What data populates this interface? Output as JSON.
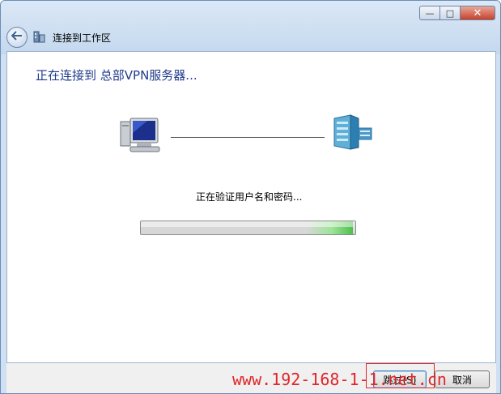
{
  "window": {
    "title": "连接到工作区",
    "caption_min": "—",
    "caption_max": "□",
    "caption_close": "✕"
  },
  "main": {
    "heading": "正在连接到 总部VPN服务器...",
    "status_text": "正在验证用户名和密码...",
    "progress_fraction": 0.99
  },
  "footer": {
    "skip_label": "跳过(S)",
    "cancel_label": "取消"
  },
  "watermark": "www.192-168-1-1.net.cn",
  "icons": {
    "back": "back-arrow-icon",
    "title": "network-workplace-icon",
    "client": "computer-icon",
    "server": "server-icon"
  },
  "colors": {
    "heading": "#1e3a8a",
    "progress_green": "#4cc04a",
    "highlight_red": "#e0262a"
  }
}
